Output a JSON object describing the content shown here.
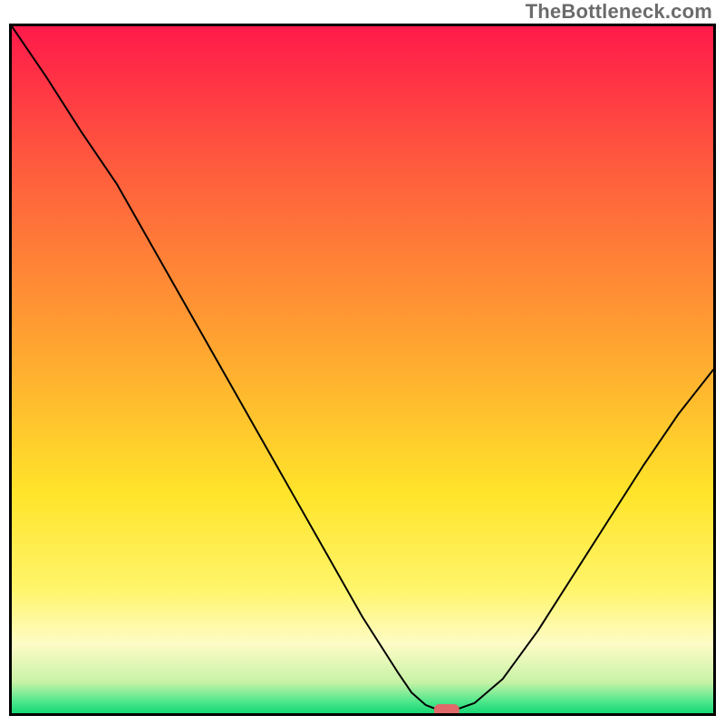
{
  "watermark": "TheBottleneck.com",
  "chart_data": {
    "type": "line",
    "title": "",
    "xlabel": "",
    "ylabel": "",
    "xlim": [
      0,
      100
    ],
    "ylim": [
      0,
      100
    ],
    "gradient_stops": [
      {
        "offset": 0.0,
        "color": "#ff1a4a"
      },
      {
        "offset": 0.2,
        "color": "#ff5a3e"
      },
      {
        "offset": 0.45,
        "color": "#ffa031"
      },
      {
        "offset": 0.68,
        "color": "#ffe42a"
      },
      {
        "offset": 0.82,
        "color": "#fff56b"
      },
      {
        "offset": 0.9,
        "color": "#fdfcc6"
      },
      {
        "offset": 0.955,
        "color": "#c7f2a6"
      },
      {
        "offset": 0.985,
        "color": "#47e68a"
      },
      {
        "offset": 1.0,
        "color": "#17d673"
      }
    ],
    "x": [
      0,
      5,
      10,
      15,
      20,
      25,
      30,
      35,
      40,
      45,
      50,
      55,
      57,
      59,
      61,
      63,
      66,
      70,
      75,
      80,
      85,
      90,
      95,
      100
    ],
    "series": [
      {
        "name": "curve",
        "values": [
          100.0,
          92.5,
          84.5,
          77.0,
          68.0,
          59.0,
          50.0,
          41.0,
          32.0,
          23.0,
          14.0,
          6.0,
          3.0,
          1.2,
          0.4,
          0.4,
          1.5,
          5.0,
          12.0,
          20.0,
          28.0,
          36.0,
          43.5,
          50.0
        ]
      }
    ],
    "marker": {
      "x": 62,
      "y": 0.4,
      "color": "#e26969"
    }
  }
}
